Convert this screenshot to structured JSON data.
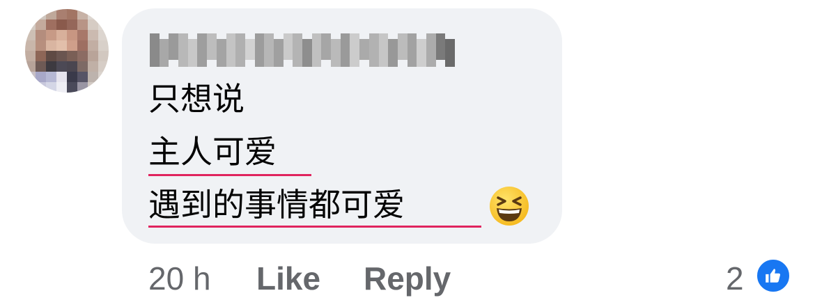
{
  "comment": {
    "author_name_blurred": "",
    "lines": [
      "只想说",
      "主人可爱",
      "遇到的事情都可爱"
    ],
    "emoji": "grinning-squinting-face",
    "underline_color": "#e0245e"
  },
  "footer": {
    "timestamp": "20 h",
    "like_label": "Like",
    "reply_label": "Reply",
    "reaction_count": "2",
    "reaction_icon": "thumbs-up-icon",
    "reaction_color": "#1877f2"
  },
  "colors": {
    "bubble_bg": "#f0f2f5",
    "text": "#050505",
    "meta_text": "#65676b"
  }
}
